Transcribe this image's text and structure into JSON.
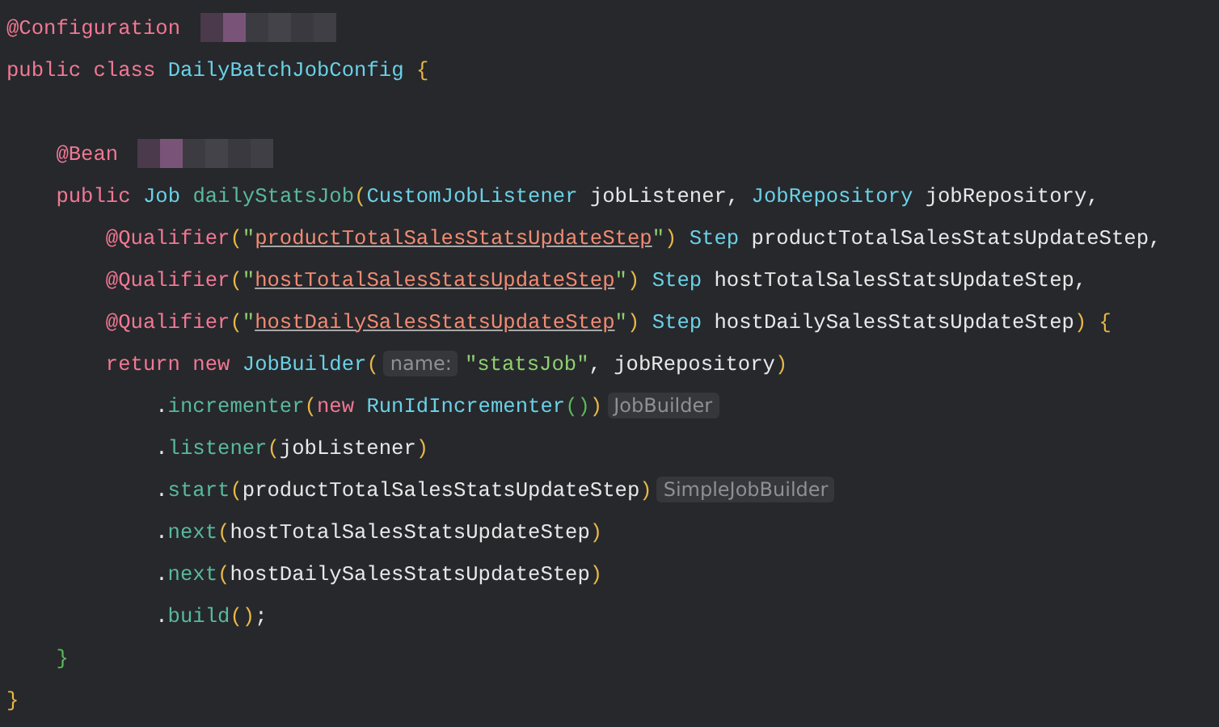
{
  "editor": {
    "lines": [
      {
        "parts": [
          {
            "kind": "code",
            "tokens": [
              {
                "text": "@Configuration",
                "kind": "annotation"
              }
            ]
          },
          {
            "kind": "redacted"
          }
        ]
      },
      {
        "parts": [
          {
            "kind": "code",
            "tokens": [
              {
                "text": "public class ",
                "kind": "keyword"
              },
              {
                "text": "DailyBatchJobConfig ",
                "kind": "type"
              },
              {
                "text": "{",
                "kind": "bracket"
              }
            ]
          }
        ],
        "children": [
          {
            "kind": "blank"
          },
          {
            "parts": [
              {
                "kind": "code",
                "tokens": [
                  {
                    "text": "@Bean",
                    "kind": "annotation"
                  }
                ]
              },
              {
                "kind": "redacted"
              }
            ]
          },
          {
            "parts": [
              {
                "kind": "code",
                "tokens": [
                  {
                    "text": "public ",
                    "kind": "keyword"
                  },
                  {
                    "text": "Job ",
                    "kind": "type"
                  },
                  {
                    "text": "dailyStatsJob",
                    "kind": "method"
                  },
                  {
                    "text": "(",
                    "kind": "bracket"
                  },
                  {
                    "text": "CustomJobListener ",
                    "kind": "type"
                  },
                  {
                    "text": "jobListener, ",
                    "kind": "plain"
                  },
                  {
                    "text": "JobRepository ",
                    "kind": "type"
                  },
                  {
                    "text": "jobRepository,",
                    "kind": "plain"
                  }
                ]
              }
            ],
            "children": [
              {
                "parts": [
                  {
                    "kind": "code",
                    "tokens": [
                      {
                        "text": "@Qualifier",
                        "kind": "annotation"
                      },
                      {
                        "text": "(",
                        "kind": "bracket"
                      },
                      {
                        "text": "\"",
                        "kind": "string"
                      },
                      {
                        "text": "productTotalSalesStatsUpdateStep",
                        "kind": "reference"
                      },
                      {
                        "text": "\"",
                        "kind": "string"
                      },
                      {
                        "text": ")",
                        "kind": "bracket"
                      },
                      {
                        "text": " Step ",
                        "kind": "type"
                      },
                      {
                        "text": "productTotalSalesStatsUpdateStep,",
                        "kind": "plain"
                      }
                    ]
                  }
                ]
              },
              {
                "parts": [
                  {
                    "kind": "code",
                    "tokens": [
                      {
                        "text": "@Qualifier",
                        "kind": "annotation"
                      },
                      {
                        "text": "(",
                        "kind": "bracket"
                      },
                      {
                        "text": "\"",
                        "kind": "string"
                      },
                      {
                        "text": "hostTotalSalesStatsUpdateStep",
                        "kind": "reference"
                      },
                      {
                        "text": "\"",
                        "kind": "string"
                      },
                      {
                        "text": ")",
                        "kind": "bracket"
                      },
                      {
                        "text": " Step ",
                        "kind": "type"
                      },
                      {
                        "text": "hostTotalSalesStatsUpdateStep,",
                        "kind": "plain"
                      }
                    ]
                  }
                ]
              },
              {
                "parts": [
                  {
                    "kind": "code",
                    "tokens": [
                      {
                        "text": "@Qualifier",
                        "kind": "annotation"
                      },
                      {
                        "text": "(",
                        "kind": "bracket"
                      },
                      {
                        "text": "\"",
                        "kind": "string"
                      },
                      {
                        "text": "hostDailySalesStatsUpdateStep",
                        "kind": "reference"
                      },
                      {
                        "text": "\"",
                        "kind": "string"
                      },
                      {
                        "text": ")",
                        "kind": "bracket"
                      },
                      {
                        "text": " Step ",
                        "kind": "type"
                      },
                      {
                        "text": "hostDailySalesStatsUpdateStep",
                        "kind": "plain"
                      },
                      {
                        "text": ") {",
                        "kind": "bracket"
                      }
                    ]
                  }
                ]
              },
              {
                "parts": [
                  {
                    "kind": "code",
                    "tokens": [
                      {
                        "text": "return new ",
                        "kind": "keyword"
                      },
                      {
                        "text": "JobBuilder",
                        "kind": "type"
                      },
                      {
                        "text": "(",
                        "kind": "bracket"
                      }
                    ]
                  },
                  {
                    "kind": "hint",
                    "text": "name:"
                  },
                  {
                    "kind": "code",
                    "tokens": [
                      {
                        "text": "\"statsJob\"",
                        "kind": "string"
                      },
                      {
                        "text": ", jobRepository",
                        "kind": "plain"
                      },
                      {
                        "text": ")",
                        "kind": "bracket"
                      }
                    ]
                  }
                ],
                "children": [
                  {
                    "parts": [
                      {
                        "kind": "code",
                        "tokens": [
                          {
                            "text": ".",
                            "kind": "plain"
                          },
                          {
                            "text": "incrementer",
                            "kind": "method"
                          },
                          {
                            "text": "(",
                            "kind": "bracket"
                          },
                          {
                            "text": "new ",
                            "kind": "keyword"
                          },
                          {
                            "text": "RunIdIncrementer",
                            "kind": "type"
                          },
                          {
                            "text": "()",
                            "kind": "inner"
                          },
                          {
                            "text": ")",
                            "kind": "bracket"
                          }
                        ]
                      },
                      {
                        "kind": "hint",
                        "text": "JobBuilder"
                      }
                    ]
                  },
                  {
                    "parts": [
                      {
                        "kind": "code",
                        "tokens": [
                          {
                            "text": ".",
                            "kind": "plain"
                          },
                          {
                            "text": "listener",
                            "kind": "method"
                          },
                          {
                            "text": "(",
                            "kind": "bracket"
                          },
                          {
                            "text": "jobListener",
                            "kind": "plain"
                          },
                          {
                            "text": ")",
                            "kind": "bracket"
                          }
                        ]
                      }
                    ]
                  },
                  {
                    "parts": [
                      {
                        "kind": "code",
                        "tokens": [
                          {
                            "text": ".",
                            "kind": "plain"
                          },
                          {
                            "text": "start",
                            "kind": "method"
                          },
                          {
                            "text": "(",
                            "kind": "bracket"
                          },
                          {
                            "text": "productTotalSalesStatsUpdateStep",
                            "kind": "plain"
                          },
                          {
                            "text": ")",
                            "kind": "bracket"
                          }
                        ]
                      },
                      {
                        "kind": "hint",
                        "text": "SimpleJobBuilder"
                      }
                    ]
                  },
                  {
                    "parts": [
                      {
                        "kind": "code",
                        "tokens": [
                          {
                            "text": ".",
                            "kind": "plain"
                          },
                          {
                            "text": "next",
                            "kind": "method"
                          },
                          {
                            "text": "(",
                            "kind": "bracket"
                          },
                          {
                            "text": "hostTotalSalesStatsUpdateStep",
                            "kind": "plain"
                          },
                          {
                            "text": ")",
                            "kind": "bracket"
                          }
                        ]
                      }
                    ]
                  },
                  {
                    "parts": [
                      {
                        "kind": "code",
                        "tokens": [
                          {
                            "text": ".",
                            "kind": "plain"
                          },
                          {
                            "text": "next",
                            "kind": "method"
                          },
                          {
                            "text": "(",
                            "kind": "bracket"
                          },
                          {
                            "text": "hostDailySalesStatsUpdateStep",
                            "kind": "plain"
                          },
                          {
                            "text": ")",
                            "kind": "bracket"
                          }
                        ]
                      }
                    ]
                  },
                  {
                    "parts": [
                      {
                        "kind": "code",
                        "tokens": [
                          {
                            "text": ".",
                            "kind": "plain"
                          },
                          {
                            "text": "build",
                            "kind": "method"
                          },
                          {
                            "text": "()",
                            "kind": "bracket"
                          },
                          {
                            "text": ";",
                            "kind": "plain"
                          }
                        ]
                      }
                    ]
                  }
                ]
              }
            ]
          },
          {
            "parts": [
              {
                "kind": "code",
                "tokens": [
                  {
                    "text": "}",
                    "kind": "inner"
                  }
                ]
              }
            ]
          }
        ]
      },
      {
        "parts": [
          {
            "kind": "code",
            "tokens": [
              {
                "text": "}",
                "kind": "bracket"
              }
            ]
          }
        ]
      }
    ]
  }
}
